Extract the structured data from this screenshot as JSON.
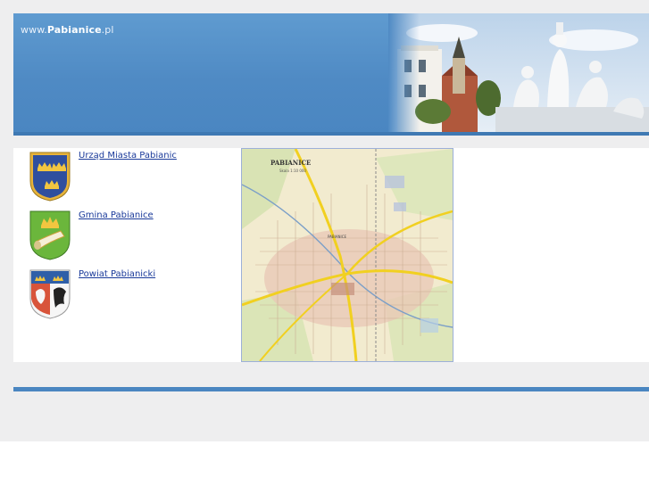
{
  "header": {
    "url_prefix": "www.",
    "url_name": "Pabianice",
    "url_suffix": ".pl"
  },
  "links": [
    {
      "label": "Urząd Miasta Pabianic",
      "crest": "crowns-crest-icon"
    },
    {
      "label": "Gmina Pabianice",
      "crest": "horn-crest-icon"
    },
    {
      "label": "Powiat Pabianicki",
      "crest": "eagle-crest-icon"
    }
  ],
  "map": {
    "title": "PABIANICE",
    "scale": "Skala 1:10 000",
    "district_label": "PABIANICE"
  },
  "colors": {
    "banner_blue": "#4f8ac4",
    "link_blue": "#1a3a9a",
    "page_gray": "#eeeeef"
  }
}
